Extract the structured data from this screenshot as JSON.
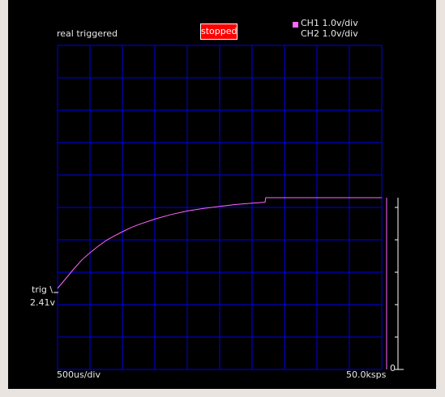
{
  "status": {
    "mode_label": "real triggered",
    "state_label": "stopped"
  },
  "channels": [
    {
      "label": "CH1 1.0v/div",
      "color": "#ff66ff"
    },
    {
      "label": "CH2 1.0v/div"
    }
  ],
  "trigger": {
    "label": "trig \\",
    "level": "2.41v"
  },
  "footer": {
    "timebase": "500us/div",
    "sample_rate": "50.0ksps"
  },
  "scale": {
    "zero_label": "0"
  },
  "colors": {
    "grid": "#0000ee",
    "trace": "#ff66ff",
    "scale": "#ffffff",
    "background": "#000000"
  },
  "chart_data": {
    "type": "line",
    "title": "",
    "xlabel": "",
    "ylabel": "",
    "grid": true,
    "divisions": {
      "x": 10,
      "y": 10
    },
    "x_unit": "div",
    "y_unit": "div",
    "xlim": [
      0,
      10
    ],
    "ylim": [
      0,
      10
    ],
    "series": [
      {
        "name": "CH1 1.0v/div",
        "x": [
          0,
          0.25,
          0.5,
          0.75,
          1.0,
          1.25,
          1.5,
          1.75,
          2.0,
          2.25,
          2.5,
          3.0,
          3.5,
          4.0,
          4.5,
          5.0,
          5.5,
          6.0,
          6.4,
          6.42,
          6.5,
          7.0,
          8.0,
          9.0,
          10.0
        ],
        "values": [
          2.5,
          2.8,
          3.1,
          3.38,
          3.6,
          3.8,
          3.98,
          4.12,
          4.25,
          4.37,
          4.47,
          4.64,
          4.78,
          4.89,
          4.97,
          5.03,
          5.09,
          5.13,
          5.16,
          5.3,
          5.3,
          5.3,
          5.3,
          5.3,
          5.3
        ]
      }
    ]
  }
}
